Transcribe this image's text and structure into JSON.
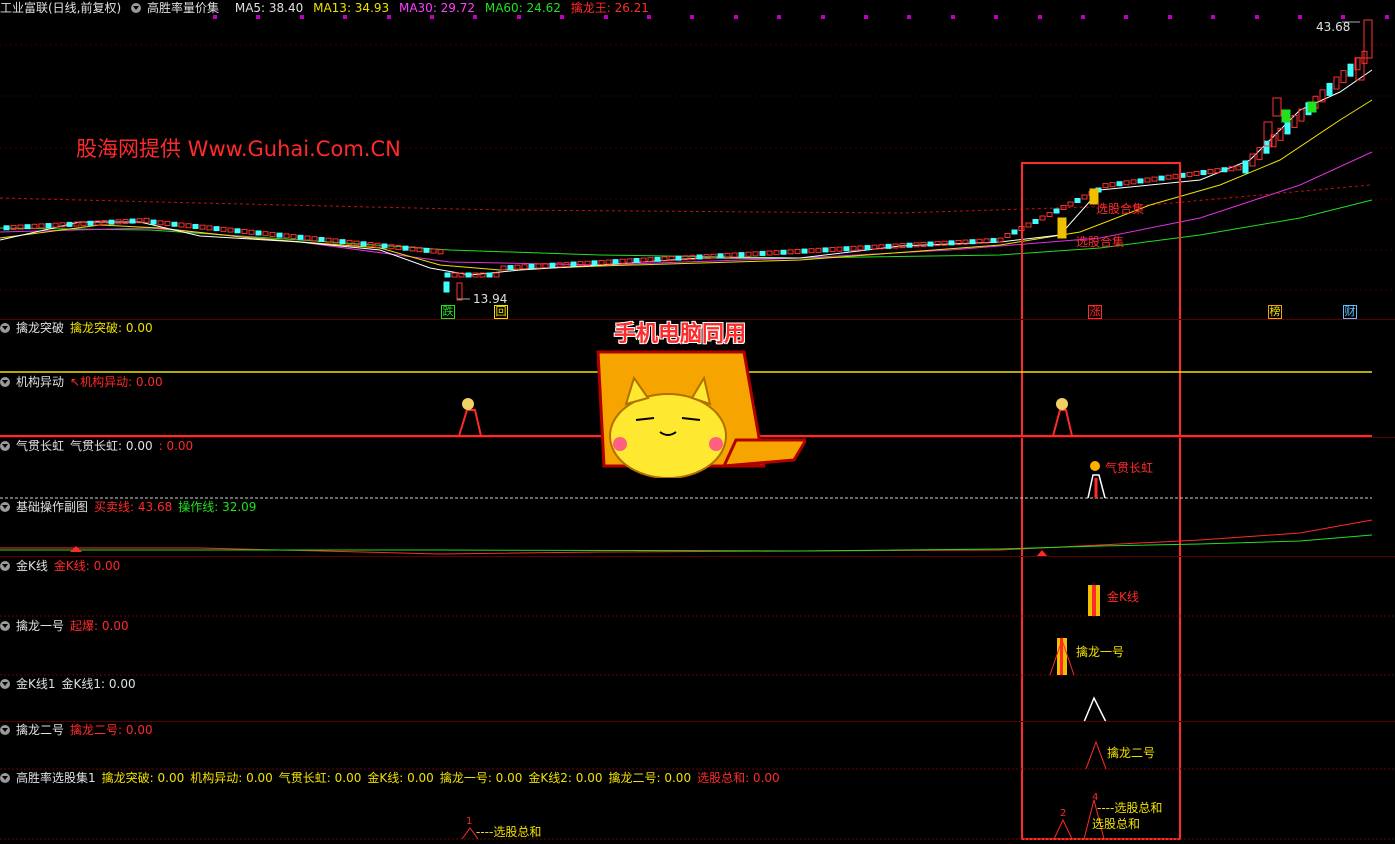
{
  "title_bar": {
    "instrument": "工业富联(日线,前复权)",
    "formula": "高胜率量价集",
    "ma5": "MA5: 38.40",
    "ma13": "MA13: 34.93",
    "ma30": "MA30: 29.72",
    "ma60": "MA60: 24.62",
    "qinglong": "擒龙王: 26.21"
  },
  "price_labels": {
    "high": "43.68",
    "low": "13.94"
  },
  "watermark": "股海网提供 Www.Guhai.Com.CN",
  "promo_text": "手机电脑同用",
  "chart_annotations": {
    "xuangu_heji_1": "选股合集",
    "xuangu_heji_2": "选股合集"
  },
  "event_tags": {
    "die": "跌",
    "hui": "回",
    "zhang": "涨",
    "bang": "榜",
    "cai": "财"
  },
  "panels": [
    {
      "name": "擒龙突破",
      "items": [
        {
          "text": "擒龙突破: 0.00",
          "color": "#f0e000"
        }
      ]
    },
    {
      "name": "机构异动",
      "items": [
        {
          "text": "↖机构异动: 0.00",
          "color": "#ff2a2a"
        }
      ]
    },
    {
      "name": "气贯长虹",
      "items": [
        {
          "text": "气贯长虹: 0.00",
          "color": "#e0e0e0"
        },
        {
          "text": ": 0.00",
          "color": "#ff2a2a"
        }
      ]
    },
    {
      "name": "基础操作副图",
      "items": [
        {
          "text": "买卖线: 43.68",
          "color": "#ff2a2a"
        },
        {
          "text": "操作线: 32.09",
          "color": "#20e020"
        }
      ]
    },
    {
      "name": "金K线",
      "items": [
        {
          "text": "金K线: 0.00",
          "color": "#ff2a2a"
        }
      ]
    },
    {
      "name": "擒龙一号",
      "items": [
        {
          "text": "起爆: 0.00",
          "color": "#ff2a2a"
        }
      ]
    },
    {
      "name": "金K线1",
      "items": [
        {
          "text": "金K线1: 0.00",
          "color": "#e0e0e0"
        }
      ]
    },
    {
      "name": "擒龙二号",
      "items": [
        {
          "text": "擒龙二号: 0.00",
          "color": "#ff2a2a"
        }
      ]
    },
    {
      "name": "高胜率选股集1",
      "items": [
        {
          "text": "擒龙突破: 0.00",
          "color": "#f0e000"
        },
        {
          "text": "机构异动: 0.00",
          "color": "#f0e000"
        },
        {
          "text": "气贯长虹: 0.00",
          "color": "#f0e000"
        },
        {
          "text": "金K线: 0.00",
          "color": "#f0e000"
        },
        {
          "text": "擒龙一号: 0.00",
          "color": "#f0e000"
        },
        {
          "text": "金K线2: 0.00",
          "color": "#f0e000"
        },
        {
          "text": "擒龙二号: 0.00",
          "color": "#f0e000"
        },
        {
          "text": "选股总和: 0.00",
          "color": "#ff2a2a"
        }
      ]
    }
  ],
  "signal_labels": {
    "qiguan": "气贯长虹",
    "jink": "金K线",
    "qinglong1": "擒龙一号",
    "qinglong2": "擒龙二号",
    "sum1": "----选股总和",
    "sum2": "----选股总和",
    "sum3": "选股总和",
    "sum1_count": "1",
    "sum2_count": "2",
    "sum3_count": "4"
  },
  "colors": {
    "up": "#ff3030",
    "down": "#40ffff",
    "ma5": "#ffffff",
    "ma13": "#f0e000",
    "ma30": "#ff40ff",
    "ma60": "#20e020",
    "frame": "#ff2a2a"
  }
}
